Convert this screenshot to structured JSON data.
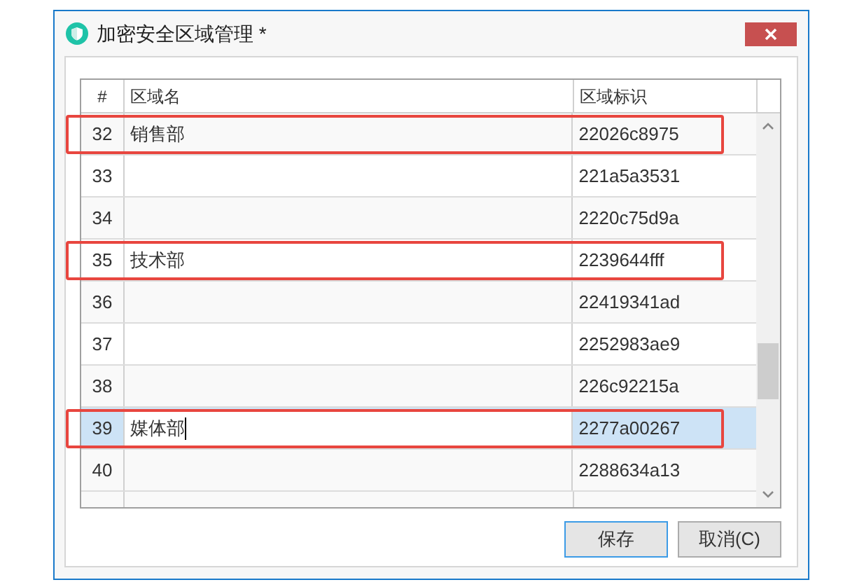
{
  "window": {
    "title": "加密安全区域管理 *"
  },
  "table": {
    "columns": [
      "#",
      "区域名",
      "区域标识"
    ],
    "rows": [
      {
        "number": "32",
        "name": "销售部",
        "id": "22026c8975",
        "selected": false,
        "editing": false,
        "highlighted": true
      },
      {
        "number": "33",
        "id": "221a5a3531",
        "selected": false,
        "editing": false,
        "highlighted": false
      },
      {
        "number": "34",
        "id": "2220c75d9a",
        "selected": false,
        "editing": false,
        "highlighted": false
      },
      {
        "number": "35",
        "name": "技术部",
        "id": "2239644fff",
        "selected": false,
        "editing": false,
        "highlighted": true
      },
      {
        "number": "36",
        "id": "22419341ad",
        "selected": false,
        "editing": false,
        "highlighted": false
      },
      {
        "number": "37",
        "id": "2252983ae9",
        "selected": false,
        "editing": false,
        "highlighted": false
      },
      {
        "number": "38",
        "id": "226c92215a",
        "selected": false,
        "editing": false,
        "highlighted": false
      },
      {
        "number": "39",
        "name": "媒体部",
        "id": "2277a00267",
        "selected": true,
        "editing": true,
        "highlighted": true
      },
      {
        "number": "40",
        "id": "2288634a13",
        "selected": false,
        "editing": false,
        "highlighted": false
      }
    ]
  },
  "buttons": [
    {
      "label": "保存",
      "kind": "default"
    },
    {
      "label": "取消(C)",
      "kind": "normal"
    }
  ]
}
